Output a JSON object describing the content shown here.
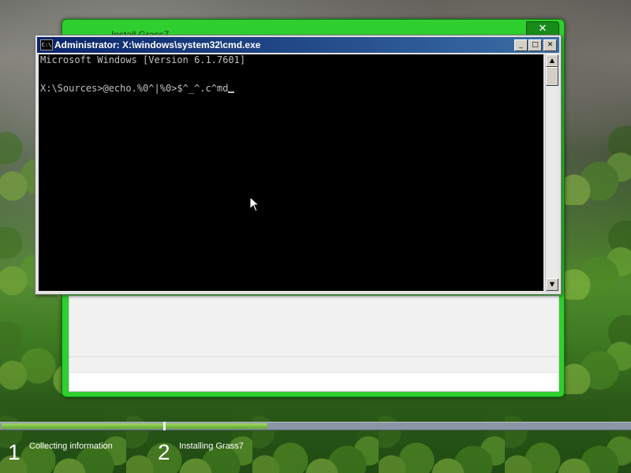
{
  "setup_window": {
    "title": "Install Grass7",
    "close_label": "✕"
  },
  "cmd_window": {
    "title": "Administrator: X:\\windows\\system32\\cmd.exe",
    "icon_label": "C:\\",
    "buttons": {
      "minimize": "_",
      "maximize": "□",
      "close": "✕"
    },
    "console_lines": [
      "Microsoft Windows [Version 6.1.7601]",
      "X:\\Sources>@echo.%0^|%0>$^_^.c^md"
    ],
    "scroll_up": "▲",
    "scroll_down": "▼"
  },
  "progress": {
    "step1_fill_fraction": 1.0,
    "step2_fill_fraction": 0.22,
    "steps": [
      {
        "number": "1",
        "label": "Collecting information"
      },
      {
        "number": "2",
        "label": "Installing Grass7"
      }
    ]
  },
  "colors": {
    "setup_frame": "#2fcf2f",
    "console_bg": "#000000",
    "console_text": "#c0c0c0",
    "progress_fill": "#5fa82a"
  }
}
